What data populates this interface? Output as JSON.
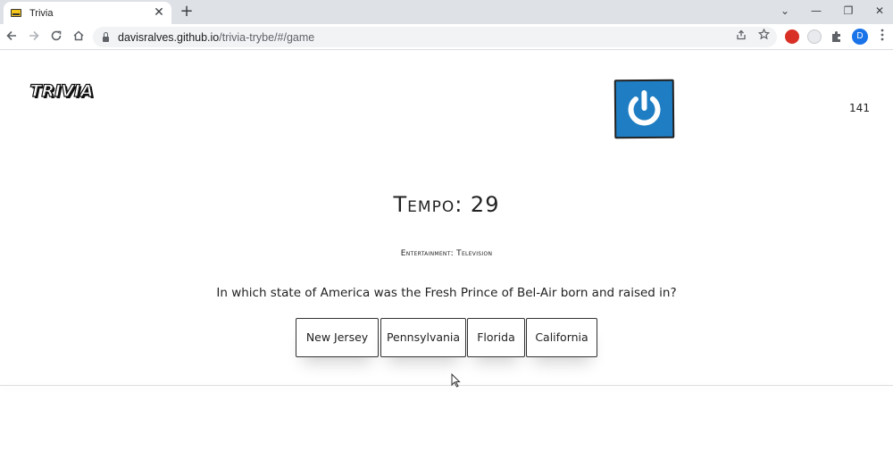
{
  "browser": {
    "tab_title": "Trivia",
    "tab_close": "✕",
    "new_tab": "+",
    "url_host": "davisralves.github.io",
    "url_path": "/trivia-trybe/#/game",
    "profile_initial": "D",
    "window_controls": {
      "dropdown": "⌄",
      "minimize": "—",
      "restore": "❐",
      "close": "✕"
    }
  },
  "header": {
    "logo_text": "TRIVIA",
    "score": "141"
  },
  "game": {
    "timer": "Tempo: 29",
    "category": "Entertainment: Television",
    "question": "In which state of America was the Fresh Prince of Bel-Air born and raised in?",
    "answers": [
      "New Jersey",
      "Pennsylvania",
      "Florida",
      "California"
    ]
  },
  "colors": {
    "avatar_bg": "#1f7ec3",
    "text": "#222222",
    "chrome_bg": "#dee1e6"
  }
}
